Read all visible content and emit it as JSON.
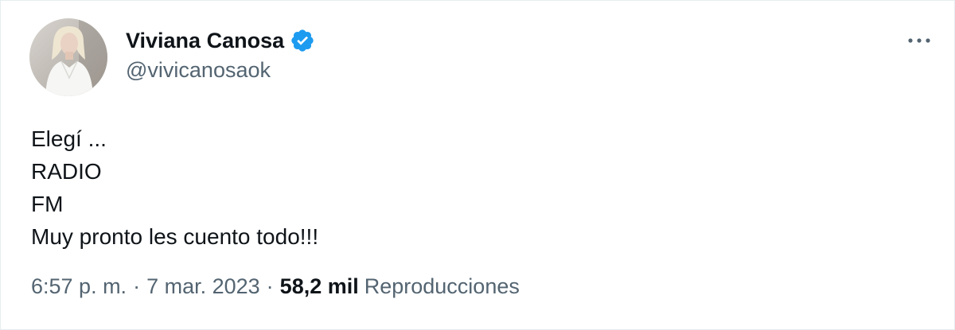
{
  "tweet": {
    "author": {
      "display_name": "Viviana Canosa",
      "handle": "@vivicanosaok",
      "verified": true
    },
    "text_lines": [
      "Elegí ...",
      "RADIO",
      "FM",
      "Muy pronto les cuento todo!!!"
    ],
    "meta": {
      "time": "6:57 p. m.",
      "separator": "·",
      "date": "7 mar. 2023",
      "views_count": "58,2 mil",
      "views_label": "Reproducciones"
    }
  },
  "colors": {
    "text_primary": "#0f1419",
    "text_secondary": "#536471",
    "verified_badge": "#1d9bf0",
    "background": "#ffffff"
  },
  "icons": {
    "verified": "verified-badge-icon",
    "more": "more-horizontal-icon"
  }
}
